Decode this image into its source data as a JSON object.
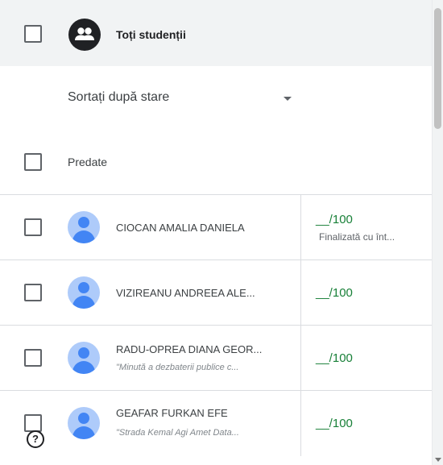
{
  "header": {
    "all_students_label": "Toți studenții",
    "sort_label": "Sortați după stare",
    "section_label": "Predate"
  },
  "students": [
    {
      "name": "CIOCAN AMALIA DANIELA",
      "sub": "",
      "grade": "__/100",
      "status": "Finalizată cu înt..."
    },
    {
      "name": "VIZIREANU ANDREEA ALE...",
      "sub": "",
      "grade": "__/100",
      "status": ""
    },
    {
      "name": "RADU-OPREA DIANA GEOR...",
      "sub": "\"Minută a dezbaterii publice c...",
      "grade": "__/100",
      "status": ""
    },
    {
      "name": "GEAFAR FURKAN EFE",
      "sub": "\"Strada Kemal Agi Amet Data...",
      "grade": "__/100",
      "status": ""
    }
  ],
  "icons": {
    "group": "people-icon",
    "avatar": "person-icon",
    "help": "help-icon",
    "help_glyph": "?"
  },
  "colors": {
    "grade_green": "#188038",
    "avatar_blue": "#4285f4",
    "header_bg": "#f1f3f4"
  }
}
